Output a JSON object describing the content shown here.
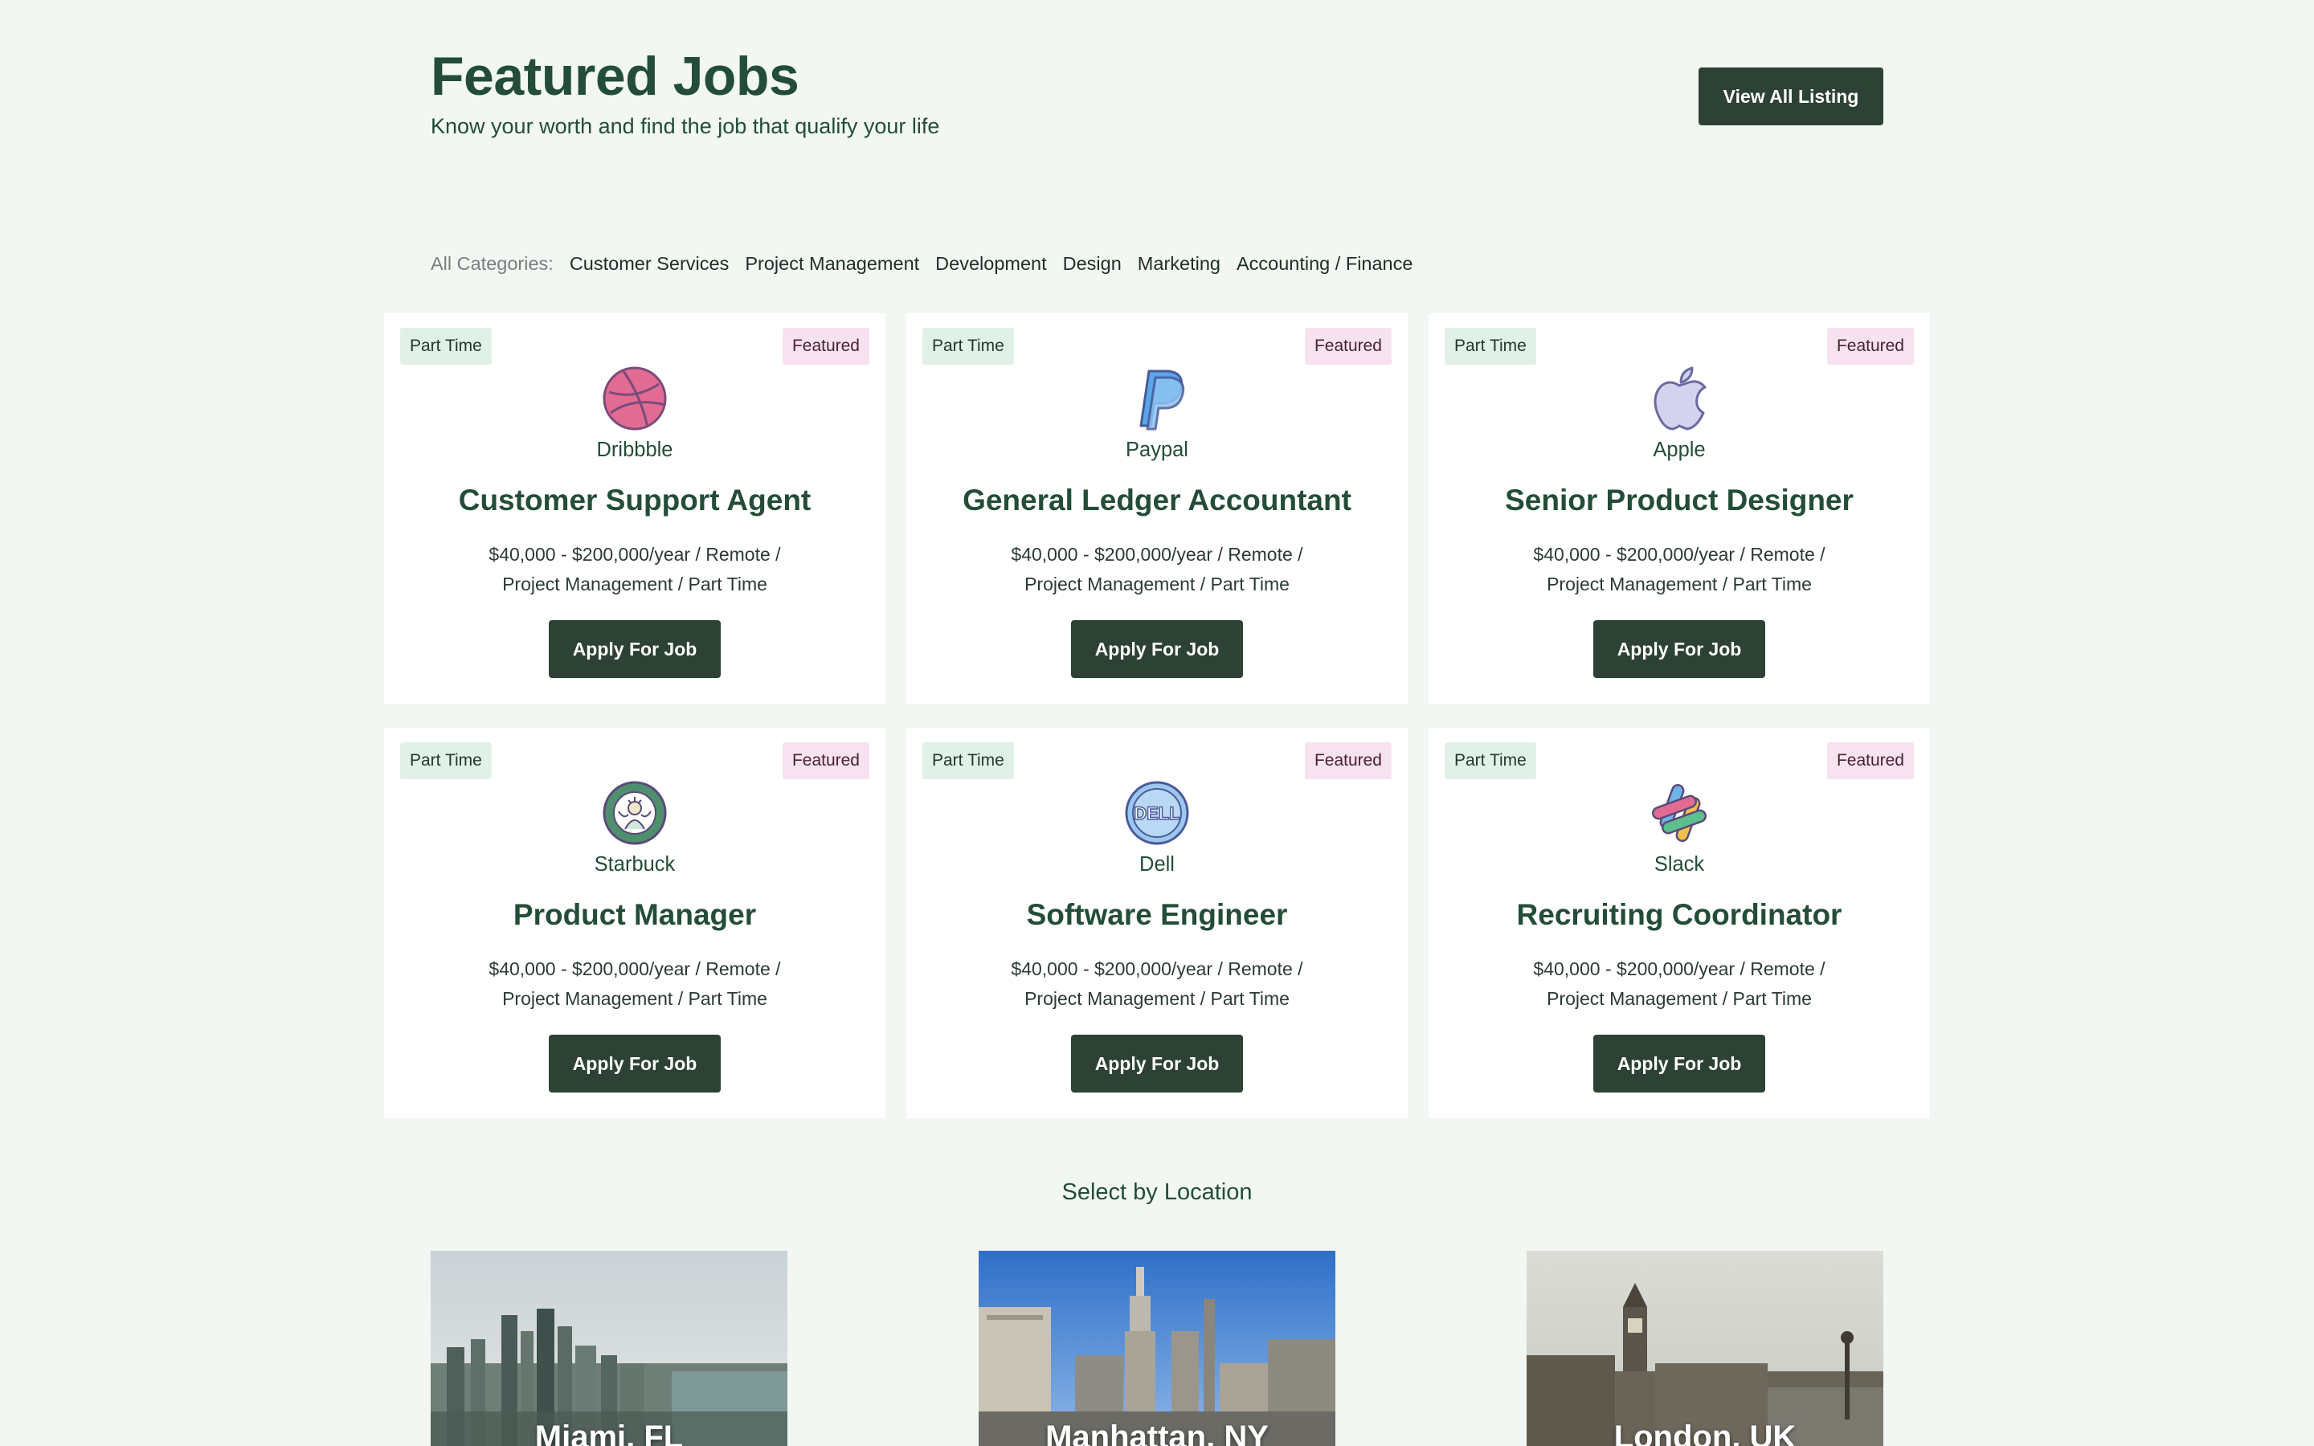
{
  "header": {
    "title": "Featured Jobs",
    "subtitle": "Know your worth and find the job that qualify your life",
    "view_all_label": "View All Listing"
  },
  "categories": {
    "label": "All Categories:",
    "items": [
      "Customer Services",
      "Project Management",
      "Development",
      "Design",
      "Marketing",
      "Accounting / Finance"
    ]
  },
  "jobs": [
    {
      "type": "Part Time",
      "badge": "Featured",
      "company": "Dribbble",
      "logo_icon": "dribbble-icon",
      "title": "Customer Support Agent",
      "meta_line1": "$40,000 - $200,000/year / Remote /",
      "meta_line2": "Project Management / Part Time",
      "apply_label": "Apply For Job"
    },
    {
      "type": "Part Time",
      "badge": "Featured",
      "company": "Paypal",
      "logo_icon": "paypal-icon",
      "title": "General Ledger Accountant",
      "meta_line1": "$40,000 - $200,000/year / Remote /",
      "meta_line2": "Project Management / Part Time",
      "apply_label": "Apply For Job"
    },
    {
      "type": "Part Time",
      "badge": "Featured",
      "company": "Apple",
      "logo_icon": "apple-icon",
      "title": "Senior Product Designer",
      "meta_line1": "$40,000 - $200,000/year / Remote /",
      "meta_line2": "Project Management / Part Time",
      "apply_label": "Apply For Job"
    },
    {
      "type": "Part Time",
      "badge": "Featured",
      "company": "Starbuck",
      "logo_icon": "starbucks-icon",
      "title": "Product Manager",
      "meta_line1": "$40,000 - $200,000/year / Remote /",
      "meta_line2": "Project Management / Part Time",
      "apply_label": "Apply For Job"
    },
    {
      "type": "Part Time",
      "badge": "Featured",
      "company": "Dell",
      "logo_icon": "dell-icon",
      "title": "Software Engineer",
      "meta_line1": "$40,000 - $200,000/year / Remote /",
      "meta_line2": "Project Management / Part Time",
      "apply_label": "Apply For Job"
    },
    {
      "type": "Part Time",
      "badge": "Featured",
      "company": "Slack",
      "logo_icon": "slack-icon",
      "title": "Recruiting Coordinator",
      "meta_line1": "$40,000 - $200,000/year / Remote /",
      "meta_line2": "Project Management / Part Time",
      "apply_label": "Apply For Job"
    }
  ],
  "locations": {
    "title": "Select by Location",
    "items": [
      {
        "name": "Miami, FL"
      },
      {
        "name": "Manhattan, NY"
      },
      {
        "name": "London, UK"
      }
    ]
  },
  "colors": {
    "background": "#f2f7f3",
    "primary_dark": "#2d4234",
    "heading_green": "#234d38",
    "tag_green_bg": "#e2f1e7",
    "tag_pink_bg": "#f7e2ef"
  }
}
